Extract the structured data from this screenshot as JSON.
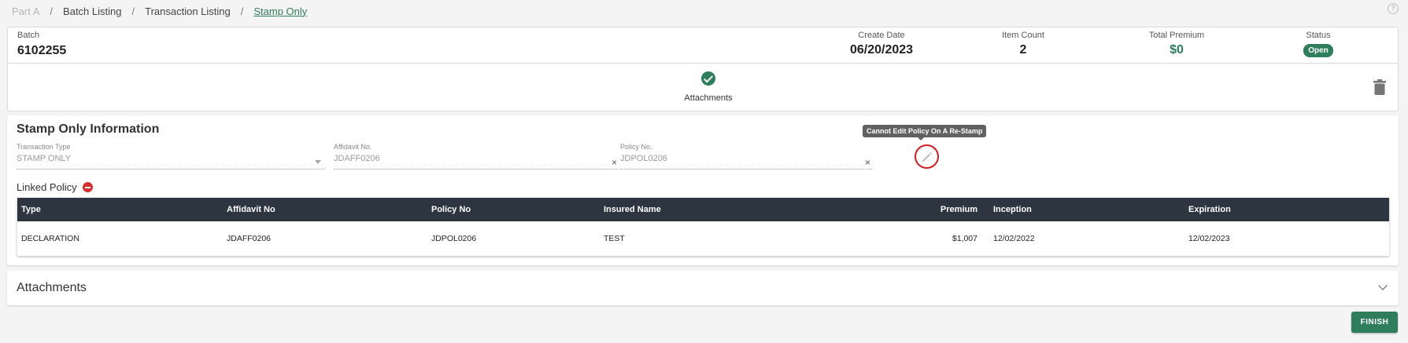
{
  "breadcrumb": [
    "Part A",
    "Batch Listing",
    "Transaction Listing",
    "Stamp Only"
  ],
  "help_icon": "?",
  "batch": {
    "batch_label": "Batch",
    "batch_value": "6102255",
    "create_date_label": "Create Date",
    "create_date_value": "06/20/2023",
    "item_count_label": "Item Count",
    "item_count_value": "2",
    "total_premium_label": "Total Premium",
    "total_premium_value": "$0",
    "status_label": "Status",
    "status_value": "Open"
  },
  "steps": {
    "attachments_label": "Attachments"
  },
  "stamp": {
    "title": "Stamp Only Information",
    "transaction_type_label": "Transaction Type",
    "transaction_type_value": "STAMP ONLY",
    "affidavit_label": "Affidavit No.",
    "affidavit_value": "JDAFF0206",
    "policy_label": "Policy No.",
    "policy_value": "JDPOL0206",
    "clear_glyph": "×",
    "tooltip": "Cannot Edit Policy On A Re-Stamp",
    "linked_label": "Linked Policy"
  },
  "table": {
    "columns": [
      "Type",
      "Affidavit No",
      "Policy No",
      "Insured Name",
      "Premium",
      "Inception",
      "Expiration"
    ],
    "rows": [
      [
        "DECLARATION",
        "JDAFF0206",
        "JDPOL0206",
        "TEST",
        "$1,007",
        "12/02/2022",
        "12/02/2023"
      ]
    ]
  },
  "attachments_section": {
    "title": "Attachments"
  },
  "finish_label": "FINISH",
  "colors": {
    "accent": "#2e7d5b",
    "header": "#2c3540",
    "danger": "#d32f2f"
  }
}
